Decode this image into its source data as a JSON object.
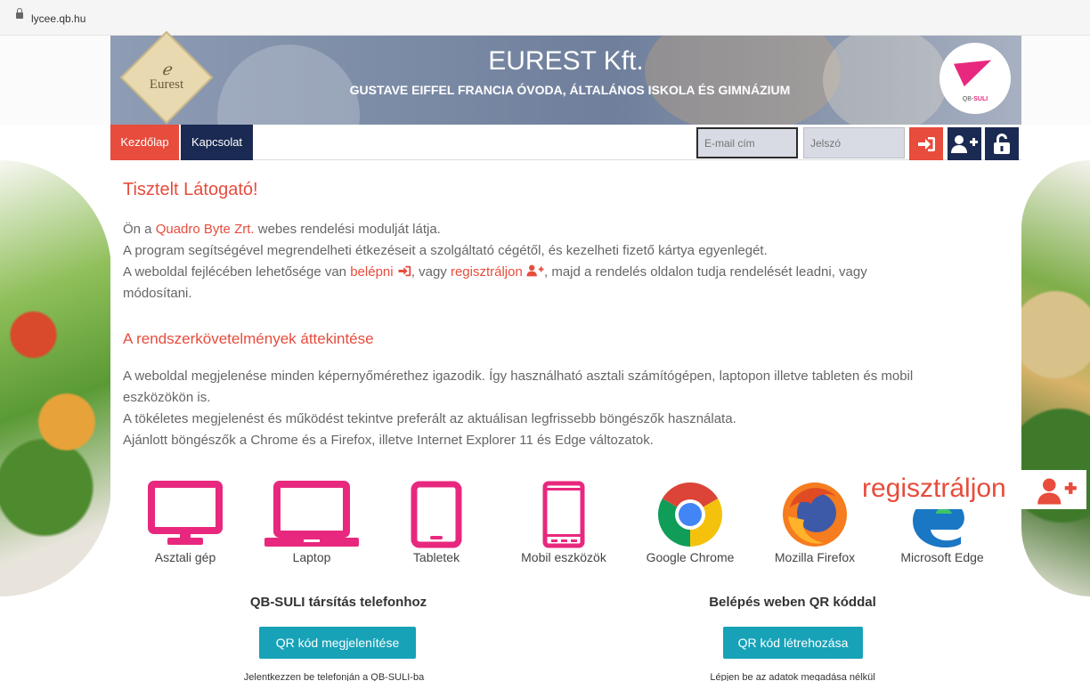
{
  "browser": {
    "url": "lycee.qb.hu"
  },
  "header": {
    "brand_logo_line1": "ℯ",
    "brand_logo_line2": "Eurest",
    "title": "EUREST Kft.",
    "subtitle": "GUSTAVE EIFFEL FRANCIA ÓVODA, ÁLTALÁNOS ISKOLA ÉS GIMNÁZIUM",
    "qb_logo_text_a": "QB-",
    "qb_logo_text_b": "SULI"
  },
  "nav": {
    "home": "Kezdőlap",
    "contact": "Kapcsolat",
    "email_placeholder": "E-mail cím",
    "password_placeholder": "Jelszó"
  },
  "welcome": {
    "title": "Tisztelt Látogató!",
    "line1_a": "Ön a ",
    "line1_link": "Quadro Byte Zrt.",
    "line1_b": " webes rendelési modulját látja.",
    "line2": "A program segítségével megrendelheti étkezéseit a szolgáltató cégétől, és kezelheti fizető kártya egyenlegét.",
    "line3_a": "A weboldal fejlécében lehetősége van ",
    "line3_login": "belépni",
    "line3_b": ", vagy ",
    "line3_register": "regisztráljon",
    "line3_c": ", majd a rendelés oldalon tudja rendelését leadni, vagy",
    "line4": "módosítani."
  },
  "requirements": {
    "title": "A rendszerkövetelmények áttekintése",
    "line1": "A weboldal megjelenése minden képernyőmérethez igazodik. Így használható asztali számítógépen, laptopon illetve tableten és mobil",
    "line2": "eszközökön is.",
    "line3": "A tökéletes megjelenést és működést tekintve preferált az aktuálisan legfrissebb böngészők használata.",
    "line4": "Ajánlott böngészők a Chrome és a Firefox, illetve Internet Explorer 11 és Edge változatok."
  },
  "devices": [
    {
      "label": "Asztali gép",
      "icon": "desktop-icon"
    },
    {
      "label": "Laptop",
      "icon": "laptop-icon"
    },
    {
      "label": "Tabletek",
      "icon": "tablet-icon"
    },
    {
      "label": "Mobil eszközök",
      "icon": "mobile-icon"
    },
    {
      "label": "Google Chrome",
      "icon": "chrome-icon"
    },
    {
      "label": "Mozilla Firefox",
      "icon": "firefox-icon"
    },
    {
      "label": "Microsoft Edge",
      "icon": "edge-icon"
    }
  ],
  "qb_pairing": {
    "title": "QB-SULI társítás telefonhoz",
    "button": "QR kód megjelenítése",
    "note": "Jelentkezzen be telefonján a QB-SULI-ba"
  },
  "qr_login": {
    "title": "Belépés weben QR kóddal",
    "button": "QR kód létrehozása",
    "note": "Lépjen be az adatok megadása nélkül"
  },
  "tooltip": {
    "text": "regisztráljon"
  },
  "colors": {
    "accent_red": "#e74c3c",
    "navy": "#1a2a52",
    "magenta": "#e8287e",
    "teal": "#17a2b8"
  }
}
